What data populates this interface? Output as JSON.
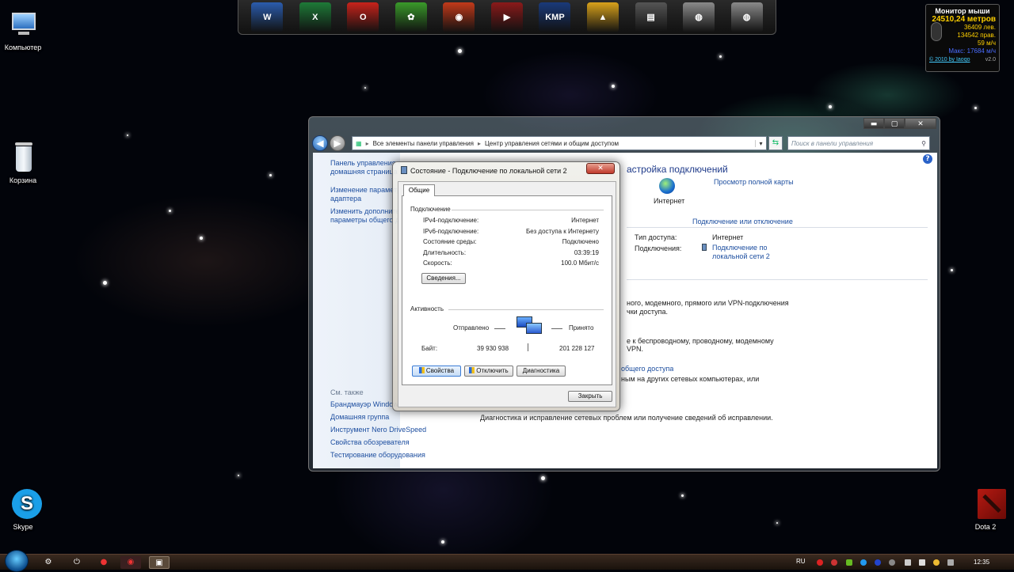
{
  "desktop": {
    "icons": [
      {
        "label": "Компьютер"
      },
      {
        "label": "Корзина"
      },
      {
        "label": "Skype"
      },
      {
        "label": "Dota 2"
      }
    ]
  },
  "dock": {
    "items": [
      {
        "name": "word-icon",
        "glyph": "W",
        "color": "#2b5cad"
      },
      {
        "name": "excel-icon",
        "glyph": "X",
        "color": "#1e7a38"
      },
      {
        "name": "opera-icon",
        "glyph": "O",
        "color": "#c8231b"
      },
      {
        "name": "icq-icon",
        "glyph": "✿",
        "color": "#3a9a2a"
      },
      {
        "name": "burn-disc-icon",
        "glyph": "◉",
        "color": "#c23a1a"
      },
      {
        "name": "media-player-icon",
        "glyph": "▶",
        "color": "#8a1a1a"
      },
      {
        "name": "kmplayer-icon",
        "glyph": "KMP",
        "color": "#1a3a7a"
      },
      {
        "name": "aimp-icon",
        "glyph": "▲",
        "color": "#d9a21b"
      },
      {
        "name": "folder-icon",
        "glyph": "▤",
        "color": "#555555"
      },
      {
        "name": "drive-icon",
        "glyph": "◍",
        "color": "#8a8a8a"
      },
      {
        "name": "drive-2-icon",
        "glyph": "◍",
        "color": "#8a8a8a"
      }
    ]
  },
  "gadget": {
    "title": "Монитор мыши",
    "distance": "24510,24 метров",
    "left_clicks": "36409 лев.",
    "right_clicks": "134542 прав.",
    "speed": "59 м/ч",
    "max_speed": "Макс: 17684 м/ч",
    "copyright": "© 2010 by Iaoqo",
    "version": "v2.0"
  },
  "window": {
    "address": {
      "root": "Все элементы панели управления",
      "current": "Центр управления сетями и общим доступом"
    },
    "search_placeholder": "Поиск в панели управления",
    "left_nav": {
      "home": "Панель управления —",
      "home2": "домашняя страница",
      "adapter1": "Изменение параметров",
      "adapter2": "адаптера",
      "sharing1": "Изменить дополнительные",
      "sharing2": "параметры общего доступа",
      "see_also": "См. также",
      "links": [
        "Брандмауэр Windows",
        "Домашняя группа",
        "Инструмент Nero DriveSpeed",
        "Свойства обозревателя",
        "Тестирование оборудования"
      ]
    },
    "main": {
      "title": "астройка подключений",
      "view_map": "Просмотр полной карты",
      "internet": "Интернет",
      "connect_disconnect": "Подключение или отключение",
      "access_type_label": "Тип доступа:",
      "access_type_value": "Интернет",
      "connections_label": "Подключения:",
      "connection_link1": "Подключение по",
      "connection_link2": "локальной сети 2",
      "text1": "ного, модемного, прямого или VPN-подключения",
      "text2": "чки доступа.",
      "text3": "е к беспроводному, проводному, модемному",
      "text4": "VPN.",
      "link_sharing": "общего доступа",
      "text5": "ным на других сетевых компьютерах, или",
      "troubleshoot": "Диагностика и исправление сетевых проблем или получение сведений об исправлении."
    }
  },
  "dialog": {
    "title": "Состояние - Подключение по локальной сети 2",
    "tab": "Общие",
    "connection_group": "Подключение",
    "rows": [
      {
        "label": "IPv4-подключение:",
        "value": "Интернет"
      },
      {
        "label": "IPv6-подключение:",
        "value": "Без доступа к Интернету"
      },
      {
        "label": "Состояние среды:",
        "value": "Подключено"
      },
      {
        "label": "Длительность:",
        "value": "03:39:19"
      },
      {
        "label": "Скорость:",
        "value": "100.0 Мбит/с"
      }
    ],
    "details_button": "Сведения...",
    "activity_group": "Активность",
    "sent_label": "Отправлено",
    "received_label": "Принято",
    "bytes_label": "Байт:",
    "bytes_sent": "39 930 938",
    "bytes_received": "201 228 127",
    "properties_button": "Свойства",
    "disable_button": "Отключить",
    "diagnose_button": "Диагностика",
    "close_button": "Закрыть"
  },
  "taskbar": {
    "language": "RU",
    "clock": "12:35"
  }
}
